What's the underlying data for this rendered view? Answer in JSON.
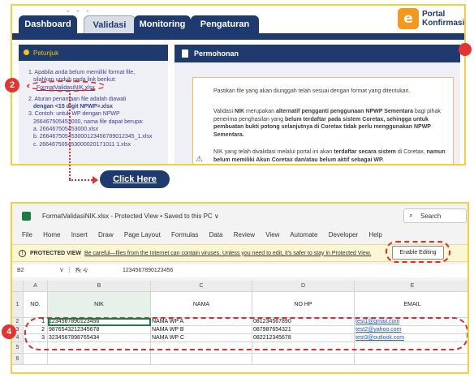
{
  "tabs": {
    "dashboard": "Dashboard",
    "validasi": "Validasi",
    "monitoring": "Monitoring",
    "pengaturan": "Pengaturan"
  },
  "logo": {
    "line1": "Portal",
    "line2": "Konfirmasi",
    "mark": "e"
  },
  "petunjuk": {
    "title": "Petunjuk",
    "lines": [
      "1. Apabila anda belum memiliki format file,",
      "silahkan unduh pada link berikut:",
      "FormatValidasiNIK.xlsx",
      "2. Aturan penamaan file adalah diawali",
      "dengan <15 digit NPWP>.xlsx",
      "3. Contoh: untuk WP dengan NPWP",
      "266467505453000, nama file dapat berupa:",
      "a.  266467505453000.xlsx",
      "b.  266467505453000123456789012345_1.xlsx",
      "c.  266467505453000020171011 1.xlsx"
    ]
  },
  "permohonan": {
    "title": "Permohonan",
    "p1": "Pastikan file yang akan diunggah telah sesuai dengan format yang ditentukan.",
    "p2a": "Validasi ",
    "p2b": "NIK",
    "p2c": " merupakan ",
    "p2d": "alternatif pengganti penggunaan NPWP Sementara",
    "p2e": " bagi pihak penerima penghasilan yang ",
    "p2f": "belum terdaftar pada sistem Coretax, sehingga untuk pembuatan bukti potong selanjutnya di Coretax tidak perlu menggunakan NPWP Sementara.",
    "p3a": "NIK yang telah divalidasi melalui portal ini akan ",
    "p3b": "terdaftar secara sistem",
    "p3c": " di Coretax, ",
    "p3d": "namun belum memiliki Akun Coretax dan/atau belum aktif sebagai WP."
  },
  "annotations": {
    "badge2": "2",
    "badge4": "4",
    "click_here": "Click Here"
  },
  "excel": {
    "title": "FormatValidasiNIK.xlsx  -  Protected View • Saved to this PC ∨",
    "search": "Search",
    "menu": [
      "File",
      "Home",
      "Insert",
      "Draw",
      "Page Layout",
      "Formulas",
      "Data",
      "Review",
      "View",
      "Automate",
      "Developer",
      "Help"
    ],
    "protected_label": "PROTECTED VIEW",
    "protected_msg": "Be careful—files from the Internet can contain viruses. Unless you need to edit, it's safer to stay in Protected View.",
    "enable_btn": "Enable Editing",
    "name_box": "B2",
    "formula_value": "1234567890123456",
    "columns": [
      "A",
      "B",
      "C",
      "D",
      "E"
    ],
    "row_numbers": [
      "1",
      "2",
      "3",
      "4",
      "5",
      "6"
    ],
    "headers": [
      "NO.",
      "NIK",
      "NAMA",
      "NO HP",
      "EMAIL"
    ],
    "rows": [
      [
        "1",
        "1234567890123456",
        "NAMA WP A",
        "081234567890",
        "test1@gmail.com"
      ],
      [
        "2",
        "9876543212345678",
        "NAMA WP B",
        "087987654321",
        "test2@yahoo.com"
      ],
      [
        "3",
        "3234567898765434",
        "NAMA WP C",
        "082212345678",
        "test3@outlook.com"
      ]
    ]
  },
  "colors": {
    "navy": "#1e3a6e",
    "accent": "#f39a1e",
    "warning": "#e52b2b",
    "excel_green": "#1d7a45",
    "frame": "#f2d23a"
  }
}
